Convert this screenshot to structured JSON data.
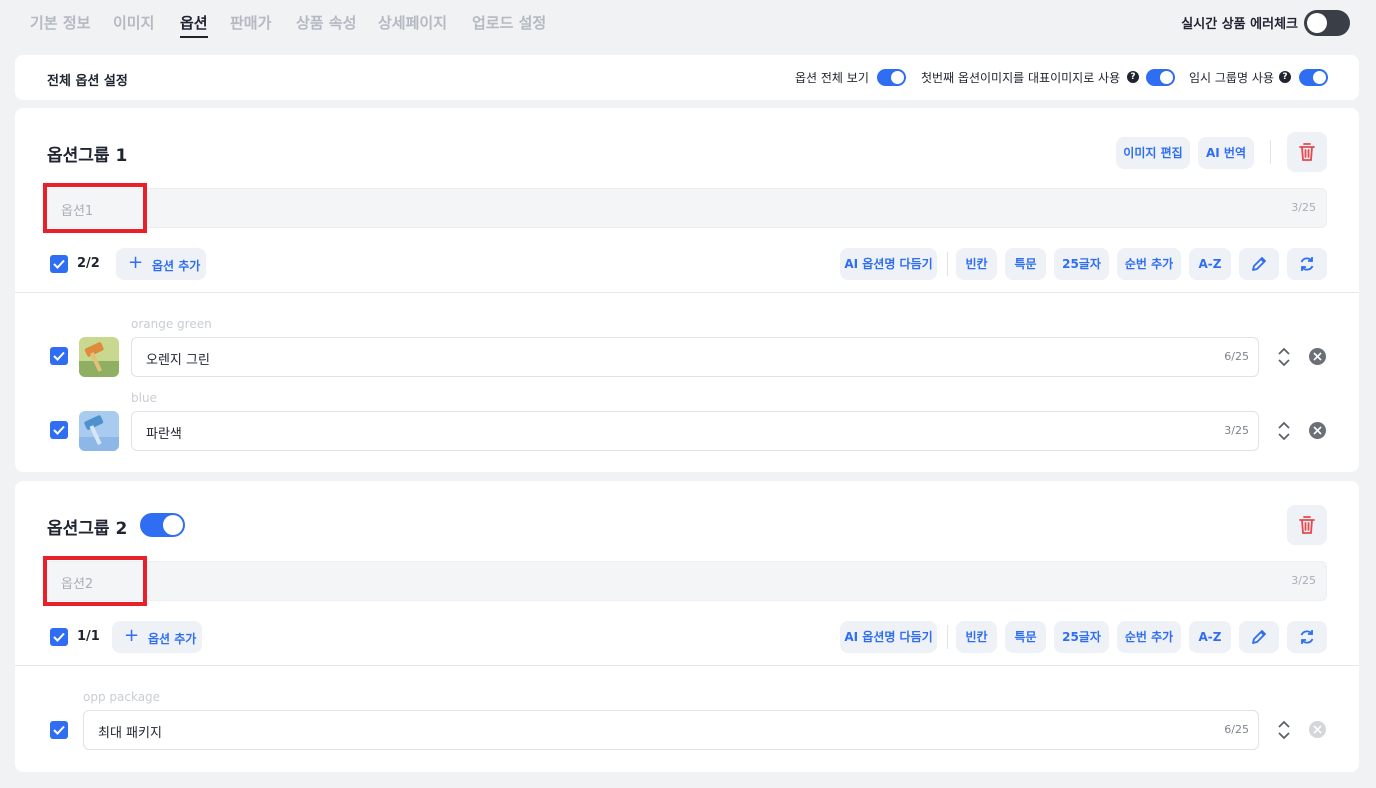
{
  "tabs": [
    "기본 정보",
    "이미지",
    "옵션",
    "판매가",
    "상품 속성",
    "상세페이지",
    "업로드 설정"
  ],
  "active_tab": "옵션",
  "realtime_check": {
    "label": "실시간 상품 에러체크",
    "on": false
  },
  "settings": {
    "title": "전체 옵션 설정",
    "view_all": {
      "label": "옵션 전체 보기",
      "on": true
    },
    "first_image": {
      "label": "첫번째 옵션이미지를 대표이미지로 사용",
      "help": "?",
      "on": true
    },
    "temp_group": {
      "label": "임시 그룹명 사용",
      "help": "?",
      "on": true
    }
  },
  "group1": {
    "title": "옵션그룹 1",
    "image_edit": "이미지 편집",
    "ai_translate": "AI 번역",
    "name_placeholder": "옵션1",
    "name_count": "3/25",
    "selected_count": "2/2",
    "add_option": "옵션 추가",
    "toolbar": [
      "AI 옵션명 다듬기",
      "빈칸",
      "특문",
      "25글자",
      "순번 추가",
      "A-Z"
    ],
    "options": [
      {
        "original": "orange green",
        "value": "오렌지 그린",
        "count": "6/25"
      },
      {
        "original": "blue",
        "value": "파란색",
        "count": "3/25"
      }
    ]
  },
  "group2": {
    "title": "옵션그룹 2",
    "enabled": true,
    "name_placeholder": "옵션2",
    "name_count": "3/25",
    "selected_count": "1/1",
    "add_option": "옵션 추가",
    "toolbar": [
      "AI 옵션명 다듬기",
      "빈칸",
      "특문",
      "25글자",
      "순번 추가",
      "A-Z"
    ],
    "options": [
      {
        "original": "opp package",
        "value": "최대 패키지",
        "count": "6/25"
      }
    ]
  },
  "colors": {
    "accent": "#2f6ef2",
    "danger": "#e8202a",
    "trash": "#e5484d"
  },
  "icons": [
    "pencil-icon",
    "refresh-icon",
    "trash-icon",
    "sort-icon",
    "remove-icon",
    "check-icon",
    "plus-icon",
    "help-icon"
  ]
}
